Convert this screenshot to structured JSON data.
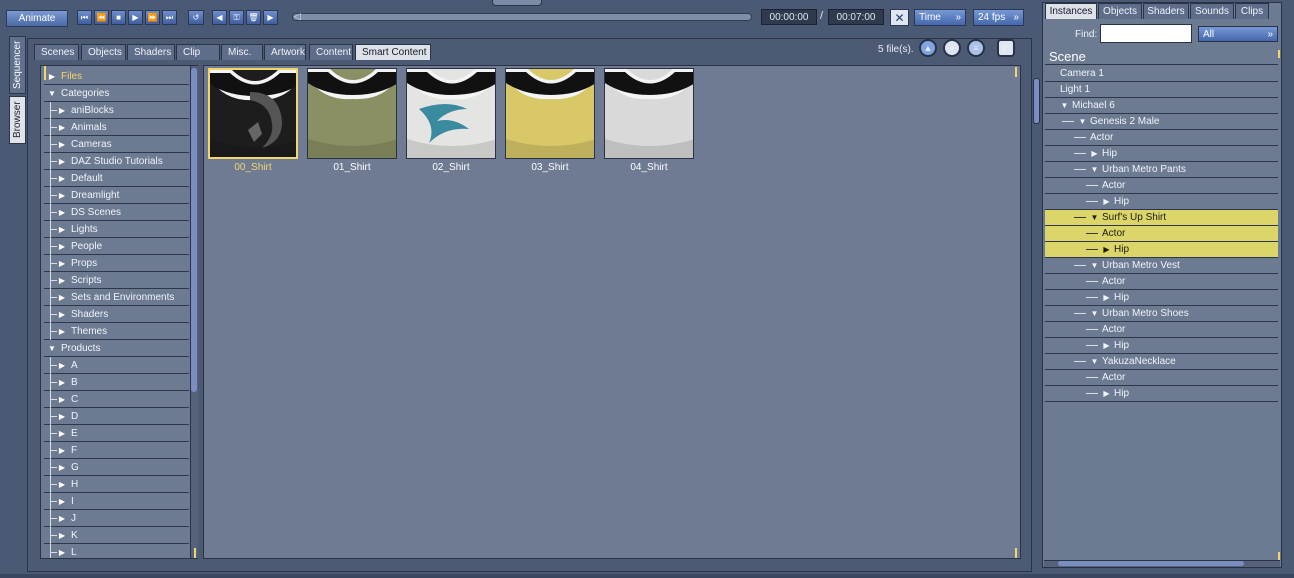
{
  "toolbar": {
    "animate_label": "Animate",
    "transport_buttons": [
      {
        "name": "go-to-start",
        "glyph": "⏮"
      },
      {
        "name": "step-back",
        "glyph": "⏪"
      },
      {
        "name": "stop",
        "glyph": "■"
      },
      {
        "name": "play",
        "glyph": "▶"
      },
      {
        "name": "step-forward",
        "glyph": "⏩"
      },
      {
        "name": "go-to-end",
        "glyph": "⏭"
      }
    ],
    "loop_glyph": "↺",
    "key_buttons": [
      {
        "name": "previous-key",
        "glyph": "◀"
      },
      {
        "name": "add-key",
        "glyph": "⚿"
      },
      {
        "name": "delete-key",
        "glyph": "🗑"
      },
      {
        "name": "next-key",
        "glyph": "▶"
      }
    ],
    "current_time": "00:00:00",
    "separator": "/",
    "total_time": "00:07:00",
    "time_mode": "Time",
    "fps": "24 fps",
    "accent_color": "#4568ab"
  },
  "side_tabs": {
    "sequencer": "Sequencer",
    "browser": "Browser"
  },
  "browser": {
    "tabs": [
      "Scenes",
      "Objects",
      "Shaders",
      "Clip",
      "Misc.",
      "Artwork",
      "Content",
      "Smart Content"
    ],
    "active_tab": "Smart Content",
    "file_count": "5 file(s).",
    "tree": {
      "files_label": "Files",
      "categories_label": "Categories",
      "categories": [
        "aniBlocks",
        "Animals",
        "Cameras",
        "DAZ Studio Tutorials",
        "Default",
        "Dreamlight",
        "DS Scenes",
        "Lights",
        "People",
        "Props",
        "Scripts",
        "Sets and Environments",
        "Shaders",
        "Themes"
      ],
      "products_label": "Products",
      "products": [
        "A",
        "B",
        "C",
        "D",
        "E",
        "F",
        "G",
        "H",
        "I",
        "J",
        "K",
        "L"
      ]
    },
    "files": [
      {
        "label": "00_Shirt",
        "selected": true,
        "color": "#1d1d1d"
      },
      {
        "label": "01_Shirt",
        "selected": false,
        "color": "#8a9064"
      },
      {
        "label": "02_Shirt",
        "selected": false,
        "color": "#e4e4e2"
      },
      {
        "label": "03_Shirt",
        "selected": false,
        "color": "#d8c868"
      },
      {
        "label": "04_Shirt",
        "selected": false,
        "color": "#d9d9d9"
      }
    ],
    "selection_color": "#f2d66b"
  },
  "right_panel": {
    "tabs": [
      "Instances",
      "Objects",
      "Shaders",
      "Sounds",
      "Clips"
    ],
    "active_tab": "Instances",
    "find_label": "Find:",
    "find_value": "",
    "filter_value": "All",
    "scene_label": "Scene",
    "instances": [
      {
        "label": "Camera 1",
        "depth": 0,
        "icon": "",
        "selected": false
      },
      {
        "label": "Light 1",
        "depth": 0,
        "icon": "",
        "selected": false
      },
      {
        "label": "Michael 6",
        "depth": 0,
        "icon": "▼",
        "selected": false
      },
      {
        "label": "Genesis 2 Male",
        "depth": 1,
        "icon": "▼",
        "selected": false
      },
      {
        "label": "Actor",
        "depth": 2,
        "icon": "",
        "selected": false
      },
      {
        "label": "Hip",
        "depth": 2,
        "icon": "▶",
        "selected": false
      },
      {
        "label": "Urban Metro Pants",
        "depth": 2,
        "icon": "▼",
        "selected": false
      },
      {
        "label": "Actor",
        "depth": 3,
        "icon": "",
        "selected": false
      },
      {
        "label": "Hip",
        "depth": 3,
        "icon": "▶",
        "selected": false
      },
      {
        "label": "Surf's Up Shirt",
        "depth": 2,
        "icon": "▼",
        "selected": true
      },
      {
        "label": "Actor",
        "depth": 3,
        "icon": "",
        "selected": true
      },
      {
        "label": "Hip",
        "depth": 3,
        "icon": "▶",
        "selected": true
      },
      {
        "label": "Urban Metro Vest",
        "depth": 2,
        "icon": "▼",
        "selected": false
      },
      {
        "label": "Actor",
        "depth": 3,
        "icon": "",
        "selected": false
      },
      {
        "label": "Hip",
        "depth": 3,
        "icon": "▶",
        "selected": false
      },
      {
        "label": "Urban Metro Shoes",
        "depth": 2,
        "icon": "▼",
        "selected": false
      },
      {
        "label": "Actor",
        "depth": 3,
        "icon": "",
        "selected": false
      },
      {
        "label": "Hip",
        "depth": 3,
        "icon": "▶",
        "selected": false
      },
      {
        "label": "YakuzaNecklace",
        "depth": 2,
        "icon": "▼",
        "selected": false
      },
      {
        "label": "Actor",
        "depth": 3,
        "icon": "",
        "selected": false
      },
      {
        "label": "Hip",
        "depth": 3,
        "icon": "▶",
        "selected": false
      }
    ],
    "highlight_color": "#dcd66a"
  }
}
